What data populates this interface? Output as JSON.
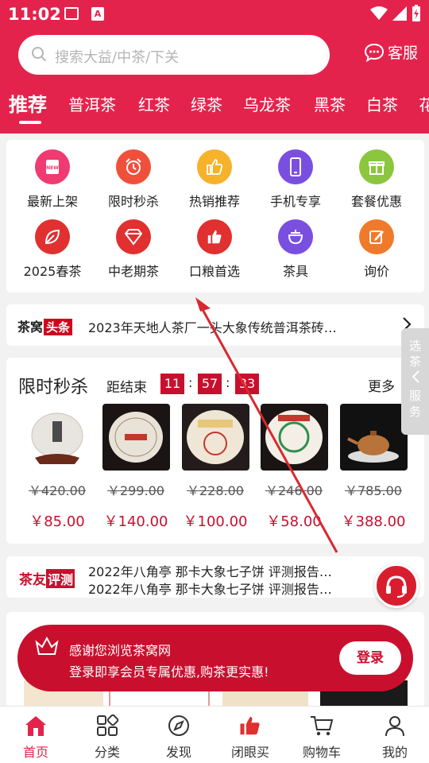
{
  "status_bar": {
    "time": "11:02"
  },
  "search": {
    "placeholder": "搜索大益/中茶/下关"
  },
  "service": {
    "label": "客服"
  },
  "tabs": [
    {
      "label": "推荐",
      "active": true
    },
    {
      "label": "普洱茶"
    },
    {
      "label": "红茶"
    },
    {
      "label": "绿茶"
    },
    {
      "label": "乌龙茶"
    },
    {
      "label": "黑茶"
    },
    {
      "label": "白茶"
    },
    {
      "label": "花"
    }
  ],
  "categories": [
    {
      "label": "最新上架",
      "icon": "new-icon",
      "color": "#ef3a72"
    },
    {
      "label": "限时秒杀",
      "icon": "alarm-clock-icon",
      "color": "#f0503a"
    },
    {
      "label": "热销推荐",
      "icon": "thumbs-up-icon",
      "color": "#f6b22b"
    },
    {
      "label": "手机专享",
      "icon": "phone-icon",
      "color": "#7a4fe0"
    },
    {
      "label": "套餐优惠",
      "icon": "gift-icon",
      "color": "#8cc63f"
    },
    {
      "label": "2025春茶",
      "icon": "leaf-icon",
      "color": "#e0302f"
    },
    {
      "label": "中老期茶",
      "icon": "diamond-icon",
      "color": "#e0302f"
    },
    {
      "label": "口粮首选",
      "icon": "thumbs-up-icon",
      "color": "#e0302f"
    },
    {
      "label": "茶具",
      "icon": "teapot-icon",
      "color": "#7a4fe0"
    },
    {
      "label": "询价",
      "icon": "edit-icon",
      "color": "#f07a2b"
    }
  ],
  "news": {
    "brand": "茶窝",
    "tag": "头条",
    "text": "2023年天地人茶厂一头大象传统普洱茶砖…"
  },
  "side_tab": {
    "line1": "选",
    "line2": "茶",
    "line3": "服",
    "line4": "务"
  },
  "flash_sale": {
    "title": "限时秒杀",
    "end_label": "距结束",
    "hours": "11",
    "minutes": "57",
    "seconds": "33",
    "more": "更多",
    "products": [
      {
        "old": "￥420.00",
        "new": "￥85.00"
      },
      {
        "old": "￥299.00",
        "new": "￥140.00"
      },
      {
        "old": "￥228.00",
        "new": "￥100.00"
      },
      {
        "old": "￥246.00",
        "new": "￥58.00"
      },
      {
        "old": "￥785.00",
        "new": "￥388.00"
      }
    ]
  },
  "review": {
    "brand": "茶友",
    "tag": "评测",
    "line1": "2022年八角亭 那卡大象七子饼 评测报告…",
    "line2": "2022年八角亭 那卡大象七子饼 评测报告…"
  },
  "login_banner": {
    "line1": "感谢您浏览茶窝网",
    "line2": "登录即享会员专属优惠,购茶更实惠!",
    "button": "登录"
  },
  "bottom_nav": [
    {
      "label": "首页",
      "icon": "home-icon",
      "active": true
    },
    {
      "label": "分类",
      "icon": "category-icon"
    },
    {
      "label": "发现",
      "icon": "compass-icon"
    },
    {
      "label": "闭眼买",
      "icon": "thumbs-up-icon"
    },
    {
      "label": "购物车",
      "icon": "cart-icon"
    },
    {
      "label": "我的",
      "icon": "user-icon"
    }
  ],
  "colors": {
    "brand": "#e4234d",
    "price": "#c8102e"
  }
}
